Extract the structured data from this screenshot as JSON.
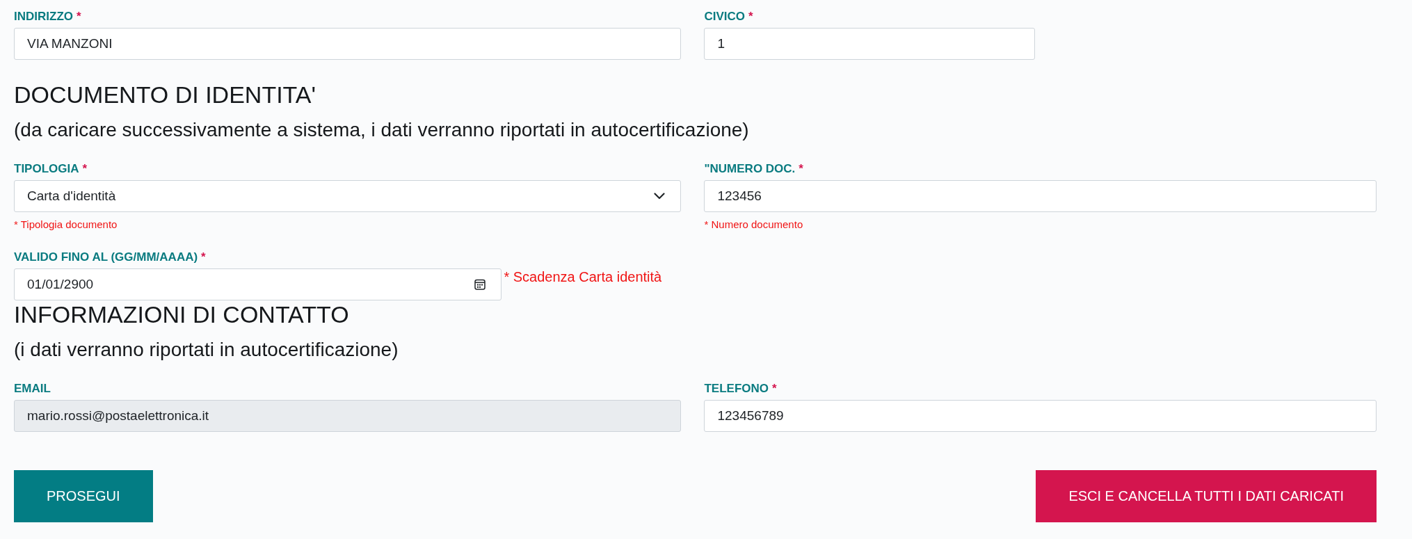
{
  "address": {
    "fields": [
      {
        "kind": "text",
        "label": "INDIRIZZO",
        "required_mark": "*",
        "value": "VIA MANZONI",
        "disabled": false
      },
      {
        "kind": "text",
        "label": "CIVICO",
        "required_mark": "*",
        "value": "1",
        "disabled": false
      }
    ]
  },
  "identity_document": {
    "title": "DOCUMENTO DI IDENTITA'",
    "subtitle": "(da caricare successivamente a sistema, i dati verranno riportati in autocertificazione)",
    "fields": [
      {
        "kind": "select",
        "label": "TIPOLOGIA",
        "required_mark": "*",
        "value": "Carta d'identità",
        "error": "* Tipologia documento",
        "disabled": false
      },
      {
        "kind": "text",
        "label": "\"NUMERO DOC.",
        "required_mark": "*",
        "value": "123456",
        "error": "* Numero documento",
        "disabled": false
      },
      {
        "kind": "date",
        "label": "VALIDO FINO AL (GG/MM/AAAA)",
        "required_mark": "*",
        "value": "01/01/2900",
        "error": "* Scadenza Carta identità",
        "disabled": false
      }
    ]
  },
  "contact": {
    "title": "INFORMAZIONI DI CONTATTO",
    "subtitle": "(i dati verranno riportati in autocertificazione)",
    "fields": [
      {
        "kind": "text",
        "label": "EMAIL",
        "value": "mario.rossi@postaelettronica.it",
        "disabled": true
      },
      {
        "kind": "text",
        "label": "TELEFONO",
        "required_mark": "*",
        "value": "123456789",
        "disabled": false
      }
    ]
  },
  "buttons": [
    {
      "kind": "primary",
      "label": "PROSEGUI"
    },
    {
      "kind": "danger",
      "label": "ESCI E CANCELLA TUTTI I DATI CARICATI"
    }
  ]
}
